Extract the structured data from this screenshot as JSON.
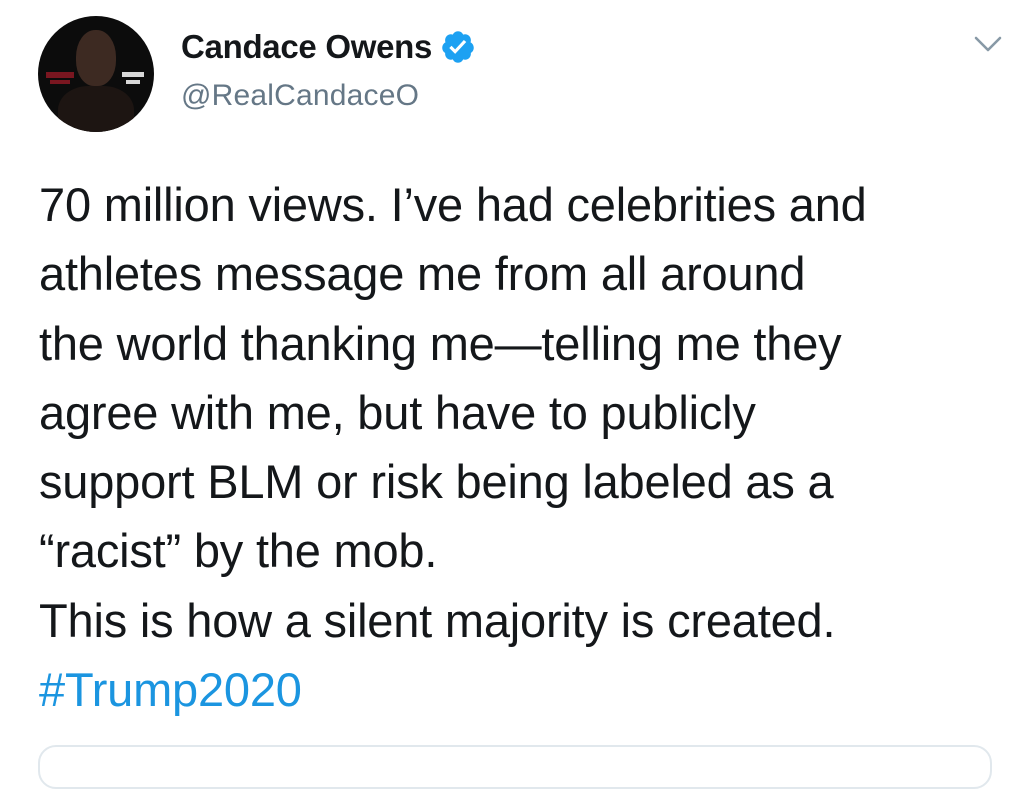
{
  "user": {
    "display_name": "Candace Owens",
    "handle": "@RealCandaceO",
    "verified": true,
    "avatar_icon": "profile-photo"
  },
  "tweet": {
    "lines": [
      "70 million views. I’ve had celebrities and",
      "athletes message me from all around",
      "the world thanking me—telling me they",
      "agree with me, but have to publicly",
      "support BLM or risk being labeled as a",
      "“racist” by the mob.",
      "This is how a silent majority is created."
    ],
    "hashtag": "#Trump2020"
  },
  "colors": {
    "text": "#14171a",
    "secondary": "#657786",
    "link": "#1b95e0",
    "verified": "#1da1f2"
  },
  "icons": {
    "verified": "verified-badge-icon",
    "menu": "chevron-down-icon"
  }
}
